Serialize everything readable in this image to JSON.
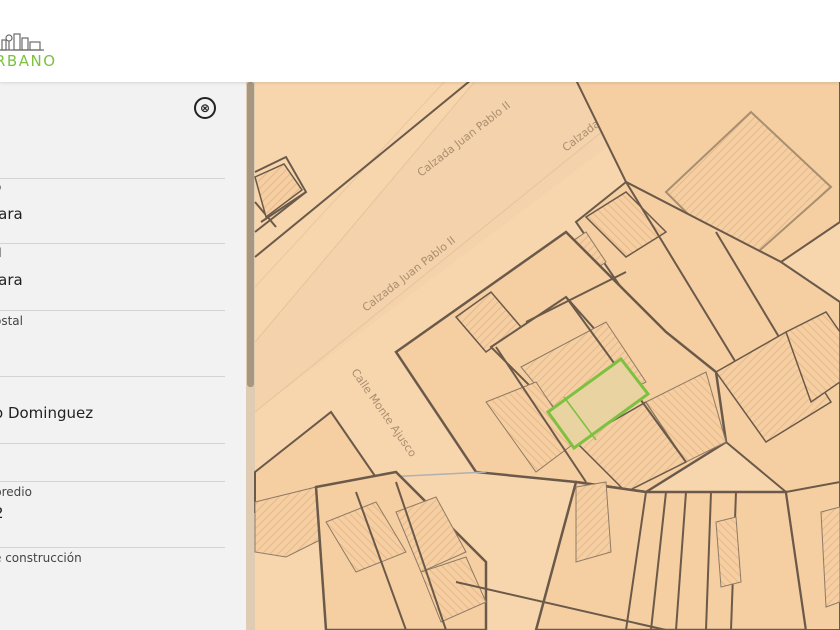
{
  "brand": {
    "logo_text": "RBANO",
    "logo_color": "#7cc142"
  },
  "panel": {
    "close_icon": "⊗",
    "fields": [
      {
        "label": "o",
        "value": "jara"
      },
      {
        "label": "d",
        "value": "jara"
      },
      {
        "label": "ostal",
        "value": ""
      },
      {
        "label": "",
        "value": "o Dominguez"
      },
      {
        "label": "",
        "value": ""
      },
      {
        "label": "predio",
        "value": "2"
      },
      {
        "label": "e construcción",
        "value": ""
      }
    ]
  },
  "map": {
    "colors": {
      "background": "#f7d6ad",
      "parcel_line": "#6b5a4a",
      "selected_parcel": "#7cc142"
    },
    "street_labels": [
      {
        "name": "Calzada Juan Pablo II",
        "instance": 1
      },
      {
        "name": "Calzada Juan Pablo II",
        "instance": 2
      },
      {
        "name": "Calzada Juan Pablo II",
        "instance": 3
      },
      {
        "name": "Calle Monte Ajusco",
        "instance": 1
      }
    ]
  }
}
